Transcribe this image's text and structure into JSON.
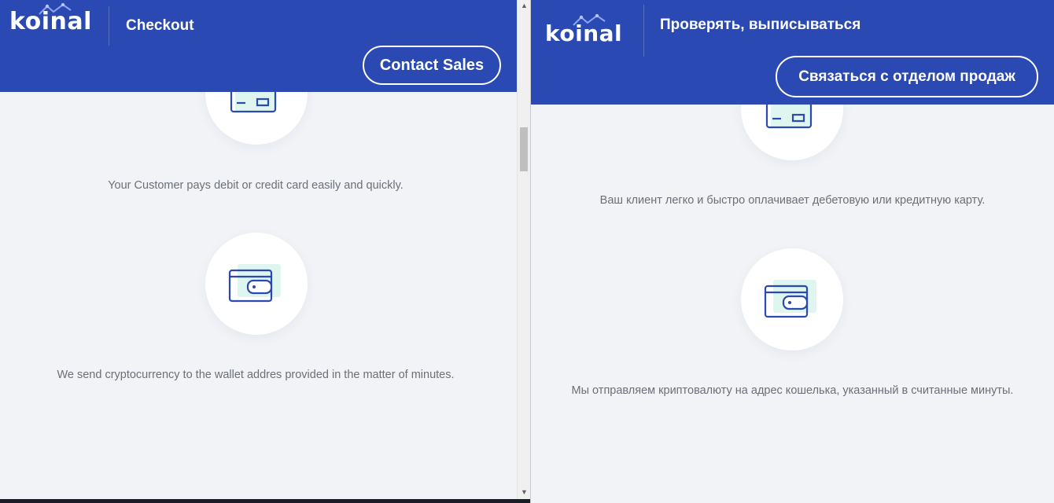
{
  "left": {
    "logo": "koinal",
    "header_title": "Checkout",
    "contact_button": "Contact Sales",
    "steps": [
      {
        "icon": "credit-card-icon",
        "text": "Your Customer pays debit or credit card easily and quickly."
      },
      {
        "icon": "wallet-icon",
        "text": "We send cryptocurrency to the wallet addres provided in the matter of minutes."
      }
    ]
  },
  "right": {
    "logo": "koinal",
    "header_title": "Проверять, выписываться",
    "contact_button": "Связаться с отделом продаж",
    "steps": [
      {
        "icon": "credit-card-icon",
        "text": "Ваш клиент легко и быстро оплачивает дебетовую или кредитную карту."
      },
      {
        "icon": "wallet-icon",
        "text": "Мы отправляем криптовалюту на адрес кошелька, указанный в считанные минуты."
      }
    ]
  },
  "scrollbar": {
    "up_icon": "arrow-up-icon",
    "down_icon": "arrow-down-icon"
  },
  "colors": {
    "header": "#2b49b3",
    "background": "#f1f3f6",
    "icon_stroke": "#2b49b3",
    "icon_accent": "#dff5ef",
    "text": "#6a6f78"
  }
}
